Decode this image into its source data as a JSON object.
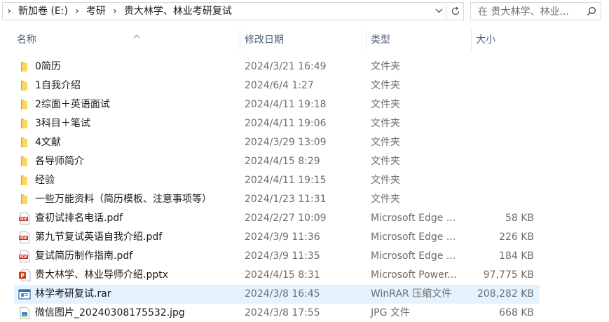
{
  "address": {
    "crumbs": [
      "新加卷 (E:)",
      "考研",
      "贵大林学、林业考研复试"
    ],
    "chevron": "›"
  },
  "search": {
    "placeholder": "在 贵大林学、林业..."
  },
  "columns": {
    "name": "名称",
    "date": "修改日期",
    "type": "类型",
    "size": "大小"
  },
  "files": [
    {
      "name": "0简历",
      "date": "2024/3/21 16:49",
      "type": "文件夹",
      "size": "",
      "icon": "folder"
    },
    {
      "name": "1自我介绍",
      "date": "2024/6/4 1:27",
      "type": "文件夹",
      "size": "",
      "icon": "folder"
    },
    {
      "name": "2综面＋英语面试",
      "date": "2024/4/11 19:18",
      "type": "文件夹",
      "size": "",
      "icon": "folder"
    },
    {
      "name": "3科目＋笔试",
      "date": "2024/4/11 19:06",
      "type": "文件夹",
      "size": "",
      "icon": "folder"
    },
    {
      "name": "4文献",
      "date": "2024/3/29 13:09",
      "type": "文件夹",
      "size": "",
      "icon": "folder"
    },
    {
      "name": "各导师简介",
      "date": "2024/4/15 8:29",
      "type": "文件夹",
      "size": "",
      "icon": "folder"
    },
    {
      "name": "经验",
      "date": "2024/4/11 19:15",
      "type": "文件夹",
      "size": "",
      "icon": "folder"
    },
    {
      "name": "一些万能资料（简历模板、注意事项等）",
      "date": "2024/1/23 11:31",
      "type": "文件夹",
      "size": "",
      "icon": "folder"
    },
    {
      "name": "查初试排名电话.pdf",
      "date": "2024/2/27 10:09",
      "type": "Microsoft Edge ...",
      "size": "58 KB",
      "icon": "pdf"
    },
    {
      "name": "第九节复试英语自我介绍.pdf",
      "date": "2024/3/9 11:36",
      "type": "Microsoft Edge ...",
      "size": "226 KB",
      "icon": "pdf"
    },
    {
      "name": "复试简历制作指南.pdf",
      "date": "2024/3/9 11:35",
      "type": "Microsoft Edge ...",
      "size": "184 KB",
      "icon": "pdf"
    },
    {
      "name": "贵大林学、林业导师介绍.pptx",
      "date": "2024/4/15 8:31",
      "type": "Microsoft Power...",
      "size": "97,775 KB",
      "icon": "pptx"
    },
    {
      "name": "林学考研复试.rar",
      "date": "2024/3/8 16:45",
      "type": "WinRAR 压缩文件",
      "size": "208,282 KB",
      "icon": "rar",
      "selected": true
    },
    {
      "name": "微信图片_20240308175532.jpg",
      "date": "2024/3/8 17:55",
      "type": "JPG 文件",
      "size": "668 KB",
      "icon": "jpg"
    }
  ],
  "colors": {
    "folder": "#f8c93c",
    "pdf": "#c8302b",
    "pptx": "#c43e1c",
    "rar": "#2f6bb0",
    "selected": "#e5f3ff"
  }
}
